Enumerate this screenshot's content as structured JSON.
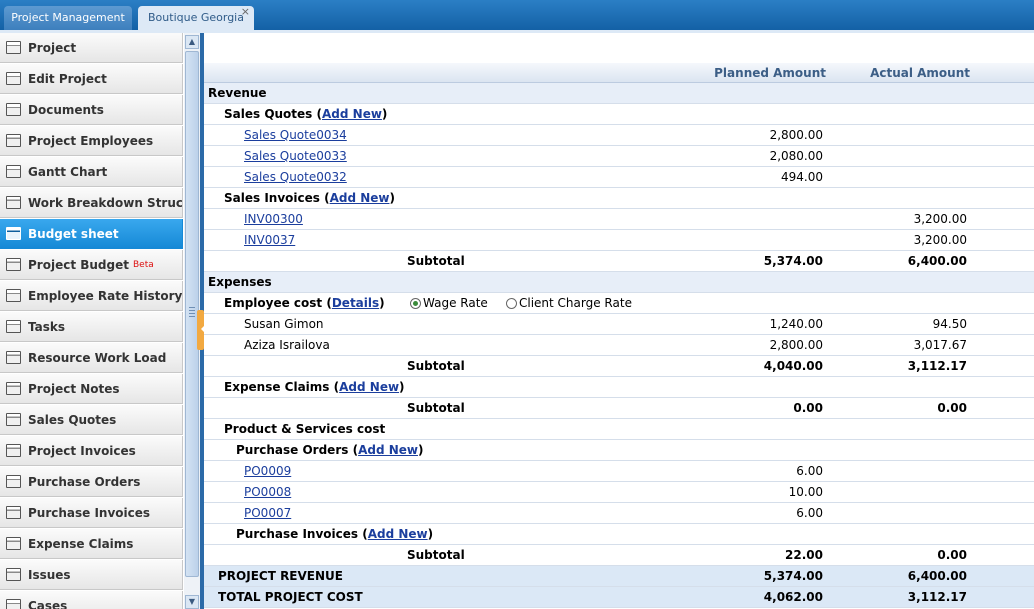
{
  "tabs": [
    {
      "label": "Project Management"
    },
    {
      "label": "Boutique Georgia",
      "close": "×"
    }
  ],
  "sidebar": {
    "items": [
      {
        "label": "Project"
      },
      {
        "label": "Edit Project"
      },
      {
        "label": "Documents"
      },
      {
        "label": "Project Employees"
      },
      {
        "label": "Gantt Chart"
      },
      {
        "label": "Work Breakdown Structure"
      },
      {
        "label": "Budget sheet"
      },
      {
        "label": "Project Budget",
        "badge": "Beta"
      },
      {
        "label": "Employee Rate History"
      },
      {
        "label": "Tasks"
      },
      {
        "label": "Resource Work Load"
      },
      {
        "label": "Project Notes"
      },
      {
        "label": "Sales Quotes"
      },
      {
        "label": "Project Invoices"
      },
      {
        "label": "Purchase Orders"
      },
      {
        "label": "Purchase Invoices"
      },
      {
        "label": "Expense Claims"
      },
      {
        "label": "Issues"
      },
      {
        "label": "Cases"
      }
    ],
    "active": "Budget sheet"
  },
  "budget": {
    "headers": {
      "planned": "Planned Amount",
      "actual": "Actual Amount"
    },
    "revenue": {
      "title": "Revenue",
      "sales_quotes": {
        "label": "Sales Quotes",
        "add_new": "Add New"
      },
      "quotes": [
        {
          "name": "Sales Quote0034",
          "planned": "2,800.00",
          "actual": ""
        },
        {
          "name": "Sales Quote0033",
          "planned": "2,080.00",
          "actual": ""
        },
        {
          "name": "Sales Quote0032",
          "planned": "494.00",
          "actual": ""
        }
      ],
      "sales_invoices": {
        "label": "Sales Invoices",
        "add_new": "Add New"
      },
      "invoices": [
        {
          "name": "INV00300",
          "planned": "",
          "actual": "3,200.00"
        },
        {
          "name": "INV0037",
          "planned": "",
          "actual": "3,200.00"
        }
      ],
      "subtotal": {
        "label": "Subtotal",
        "planned": "5,374.00",
        "actual": "6,400.00"
      }
    },
    "expenses": {
      "title": "Expenses",
      "employee_cost": {
        "label": "Employee cost",
        "details": "Details",
        "rate_options": [
          "Wage Rate",
          "Client Charge Rate"
        ],
        "selected_rate": "Wage Rate"
      },
      "employees": [
        {
          "name": "Susan Gimon",
          "planned": "1,240.00",
          "actual": "94.50"
        },
        {
          "name": "Aziza Israilova",
          "planned": "2,800.00",
          "actual": "3,017.67"
        }
      ],
      "employee_subtotal": {
        "label": "Subtotal",
        "planned": "4,040.00",
        "actual": "3,112.17"
      },
      "expense_claims": {
        "label": "Expense Claims",
        "add_new": "Add New"
      },
      "claims_subtotal": {
        "label": "Subtotal",
        "planned": "0.00",
        "actual": "0.00"
      },
      "product_services": {
        "label": "Product & Services cost"
      },
      "purchase_orders": {
        "label": "Purchase Orders",
        "add_new": "Add New"
      },
      "orders": [
        {
          "name": "PO0009",
          "planned": "6.00",
          "actual": ""
        },
        {
          "name": "PO0008",
          "planned": "10.00",
          "actual": ""
        },
        {
          "name": "PO0007",
          "planned": "6.00",
          "actual": ""
        }
      ],
      "purchase_invoices": {
        "label": "Purchase Invoices",
        "add_new": "Add New"
      },
      "products_subtotal": {
        "label": "Subtotal",
        "planned": "22.00",
        "actual": "0.00"
      }
    },
    "totals": {
      "project_revenue": {
        "label": "PROJECT REVENUE",
        "planned": "5,374.00",
        "actual": "6,400.00"
      },
      "total_cost": {
        "label": "TOTAL PROJECT COST",
        "planned": "4,062.00",
        "actual": "3,112.17"
      }
    }
  }
}
